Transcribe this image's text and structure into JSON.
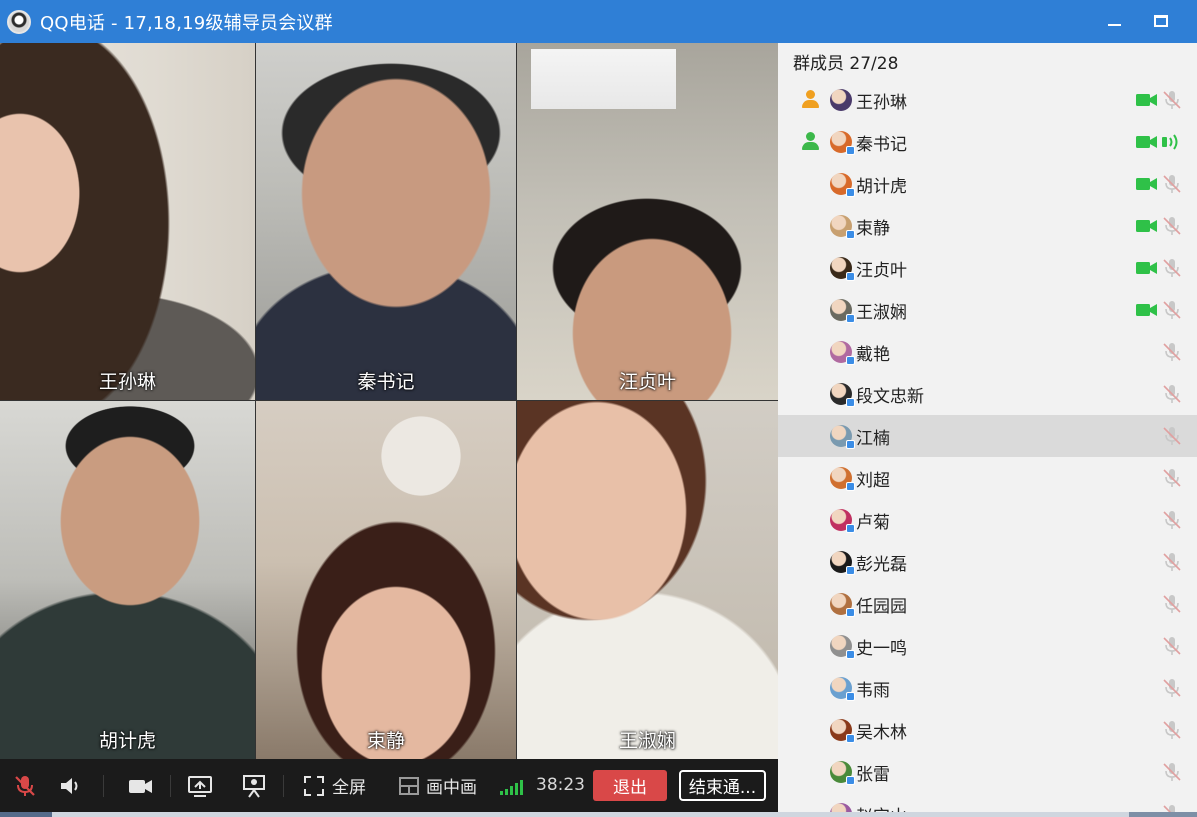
{
  "window": {
    "title": "QQ电话 - 17,18,19级辅导员会议群"
  },
  "videos": [
    {
      "name": "王孙琳"
    },
    {
      "name": "秦书记"
    },
    {
      "name": "汪贞叶"
    },
    {
      "name": "胡计虎"
    },
    {
      "name": "束静"
    },
    {
      "name": "王淑娴"
    }
  ],
  "toolbar": {
    "fullscreen_label": "全屏",
    "pip_label": "画中画",
    "timer": "38:23",
    "exit_label": "退出",
    "end_label": "结束通..."
  },
  "panel": {
    "title": "群成员 27/28",
    "members": [
      {
        "name": "王孙琳",
        "host": true,
        "host_color": "#f0a020",
        "video": true,
        "mic": "muted",
        "avatar_color": "#4a3a6a"
      },
      {
        "name": "秦书记",
        "host": true,
        "host_color": "#3cb84a",
        "video": true,
        "mic": "speaking",
        "avatar_color": "#d86a2a"
      },
      {
        "name": "胡计虎",
        "host": false,
        "video": true,
        "mic": "muted",
        "avatar_color": "#d86a2a"
      },
      {
        "name": "束静",
        "host": false,
        "video": true,
        "mic": "muted",
        "avatar_color": "#c8a070"
      },
      {
        "name": "汪贞叶",
        "host": false,
        "video": true,
        "mic": "muted",
        "avatar_color": "#3a2a1a"
      },
      {
        "name": "王淑娴",
        "host": false,
        "video": true,
        "mic": "muted",
        "avatar_color": "#6a6a60"
      },
      {
        "name": "戴艳",
        "host": false,
        "video": false,
        "mic": "muted",
        "avatar_color": "#b06aa0"
      },
      {
        "name": "段文忠新",
        "host": false,
        "video": false,
        "mic": "muted",
        "avatar_color": "#2a2a2a"
      },
      {
        "name": "江楠",
        "host": false,
        "video": false,
        "mic": "muted",
        "avatar_color": "#7a9ab0",
        "selected": true
      },
      {
        "name": "刘超",
        "host": false,
        "video": false,
        "mic": "muted",
        "avatar_color": "#d07030"
      },
      {
        "name": "卢菊",
        "host": false,
        "video": false,
        "mic": "muted",
        "avatar_color": "#c03060"
      },
      {
        "name": "彭光磊",
        "host": false,
        "video": false,
        "mic": "muted",
        "avatar_color": "#1a1a1a"
      },
      {
        "name": "任园园",
        "host": false,
        "video": false,
        "mic": "muted",
        "avatar_color": "#b07040"
      },
      {
        "name": "史一鸣",
        "host": false,
        "video": false,
        "mic": "muted",
        "avatar_color": "#909090"
      },
      {
        "name": "韦雨",
        "host": false,
        "video": false,
        "mic": "muted",
        "avatar_color": "#6aa0d0"
      },
      {
        "name": "吴木林",
        "host": false,
        "video": false,
        "mic": "muted",
        "avatar_color": "#8a3a1a"
      },
      {
        "name": "张雷",
        "host": false,
        "video": false,
        "mic": "muted",
        "avatar_color": "#4a8a3a"
      },
      {
        "name": "赵宝山",
        "host": false,
        "video": false,
        "mic": "muted",
        "avatar_color": "#9a5aa0"
      }
    ]
  },
  "colors": {
    "titlebar": "#2f7fd6",
    "video_on": "#2fc148",
    "muted": "#c8c8c8",
    "exit": "#d94848"
  }
}
